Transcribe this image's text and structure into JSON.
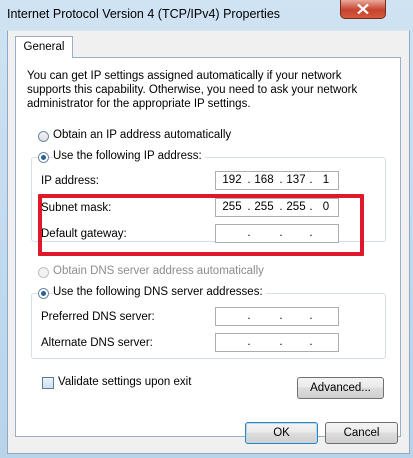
{
  "window": {
    "title": "Internet Protocol Version 4 (TCP/IPv4) Properties"
  },
  "tabs": [
    {
      "label": "General",
      "selected": true
    }
  ],
  "intro_text": "You can get IP settings assigned automatically if your network supports this capability. Otherwise, you need to ask your network administrator for the appropriate IP settings.",
  "ip": {
    "auto_label": "Obtain an IP address automatically",
    "manual_label": "Use the following IP address:",
    "selected": "manual",
    "fields": [
      {
        "label": "IP address:",
        "octets": [
          "192",
          "168",
          "137",
          "1"
        ]
      },
      {
        "label": "Subnet mask:",
        "octets": [
          "255",
          "255",
          "255",
          "0"
        ]
      },
      {
        "label": "Default gateway:",
        "octets": [
          "",
          "",
          "",
          ""
        ]
      }
    ]
  },
  "dns": {
    "auto_label": "Obtain DNS server address automatically",
    "manual_label": "Use the following DNS server addresses:",
    "selected": "manual",
    "fields": [
      {
        "label": "Preferred DNS server:",
        "octets": [
          "",
          "",
          "",
          ""
        ]
      },
      {
        "label": "Alternate DNS server:",
        "octets": [
          "",
          "",
          "",
          ""
        ]
      }
    ]
  },
  "validate_label": "Validate settings upon exit",
  "validate_checked": false,
  "buttons": {
    "advanced": "Advanced...",
    "ok": "OK",
    "cancel": "Cancel"
  },
  "colors": {
    "highlight": "#e0192a",
    "close_button": "#c7432d"
  },
  "icons": {
    "close": "close-icon"
  }
}
